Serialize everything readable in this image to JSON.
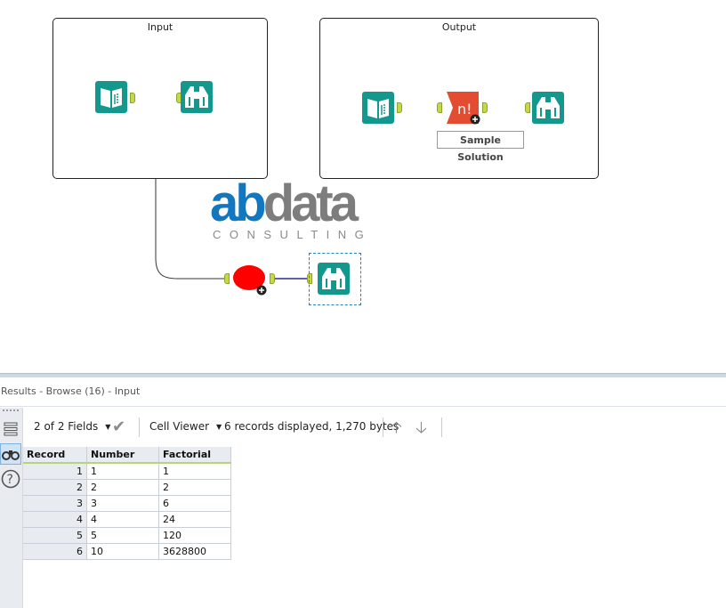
{
  "canvas": {
    "containers": [
      {
        "title": "Input"
      },
      {
        "title": "Output"
      }
    ],
    "annotation": "Sample Solution",
    "formula_tool_glyph": "n!",
    "logo": {
      "part_a": "ab",
      "part_b": "data",
      "subtitle": "CONSULTING"
    },
    "icons": {
      "input": "input-data-icon",
      "browse": "browse-icon",
      "formula": "factorial-macro-icon",
      "macro": "error-macro-icon"
    },
    "colors": {
      "tool_teal": "#14978c",
      "anchor_green": "#c6d84a",
      "macro_red": "#e34c30",
      "error_red": "#ff0000",
      "connection": "#333333",
      "selected_connection": "#2b2b8c"
    }
  },
  "results": {
    "title": "Results - Browse (16) - Input",
    "fields_selector": "2 of 2 Fields",
    "viewer": "Cell Viewer",
    "summary": "6 records displayed, 1,270 bytes",
    "columns": [
      "Record",
      "Number",
      "Factorial"
    ],
    "rows": [
      {
        "record": "1",
        "number": "1",
        "factorial": "1"
      },
      {
        "record": "2",
        "number": "2",
        "factorial": "2"
      },
      {
        "record": "3",
        "number": "3",
        "factorial": "6"
      },
      {
        "record": "4",
        "number": "4",
        "factorial": "24"
      },
      {
        "record": "5",
        "number": "5",
        "factorial": "120"
      },
      {
        "record": "6",
        "number": "10",
        "factorial": "3628800"
      }
    ]
  }
}
